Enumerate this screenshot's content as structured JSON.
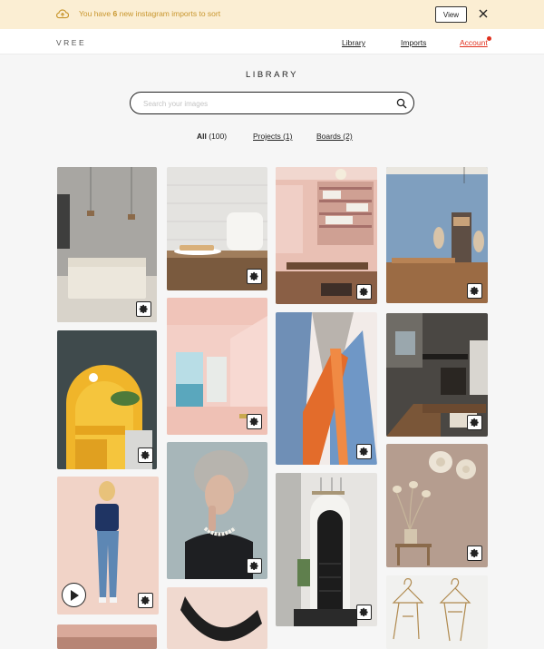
{
  "banner": {
    "message_before": "You have ",
    "count": "6",
    "message_after": " new instagram imports to sort",
    "view_label": "View"
  },
  "nav": {
    "logo": "VREE",
    "library": "Library",
    "imports": "Imports",
    "account": "Account"
  },
  "page": {
    "title": "LIBRARY"
  },
  "search": {
    "placeholder": "Search your images",
    "value": ""
  },
  "filters": [
    {
      "label": "All",
      "count": " (100)"
    },
    {
      "label": "Projects (1)"
    },
    {
      "label": "Boards (2)"
    }
  ],
  "images": [
    {
      "subject": "minimal bedroom with concrete wall and pendant lamps",
      "col": 1
    },
    {
      "subject": "yellow arched dining nook",
      "col": 1
    },
    {
      "subject": "woman in blue top and jeans (video)",
      "col": 1
    },
    {
      "subject": "pink room interior",
      "col": 1
    },
    {
      "subject": "white toaster on wood table",
      "col": 2
    },
    {
      "subject": "pastel pink architectural render",
      "col": 2
    },
    {
      "subject": "grey haired woman with pearl necklace",
      "col": 2
    },
    {
      "subject": "black woven necklace",
      "col": 2
    },
    {
      "subject": "pink wall with bookshelves and dining table",
      "col": 3
    },
    {
      "subject": "blue and orange pleated fabric",
      "col": 3
    },
    {
      "subject": "hallway with chandelier and staircase",
      "col": 3
    },
    {
      "subject": "blue studio with mannequins",
      "col": 4
    },
    {
      "subject": "loft interior with stairs",
      "col": 4
    },
    {
      "subject": "taupe wall with hats and dried flowers",
      "col": 4
    },
    {
      "subject": "line drawing of garments on hangers",
      "col": 4
    }
  ],
  "colors": {
    "banner_bg": "#fbeed3",
    "banner_text": "#c8962e",
    "account": "#e0301e"
  },
  "icons": [
    "cloud-upload-icon",
    "close-icon",
    "search-icon",
    "gear-icon",
    "play-icon"
  ]
}
